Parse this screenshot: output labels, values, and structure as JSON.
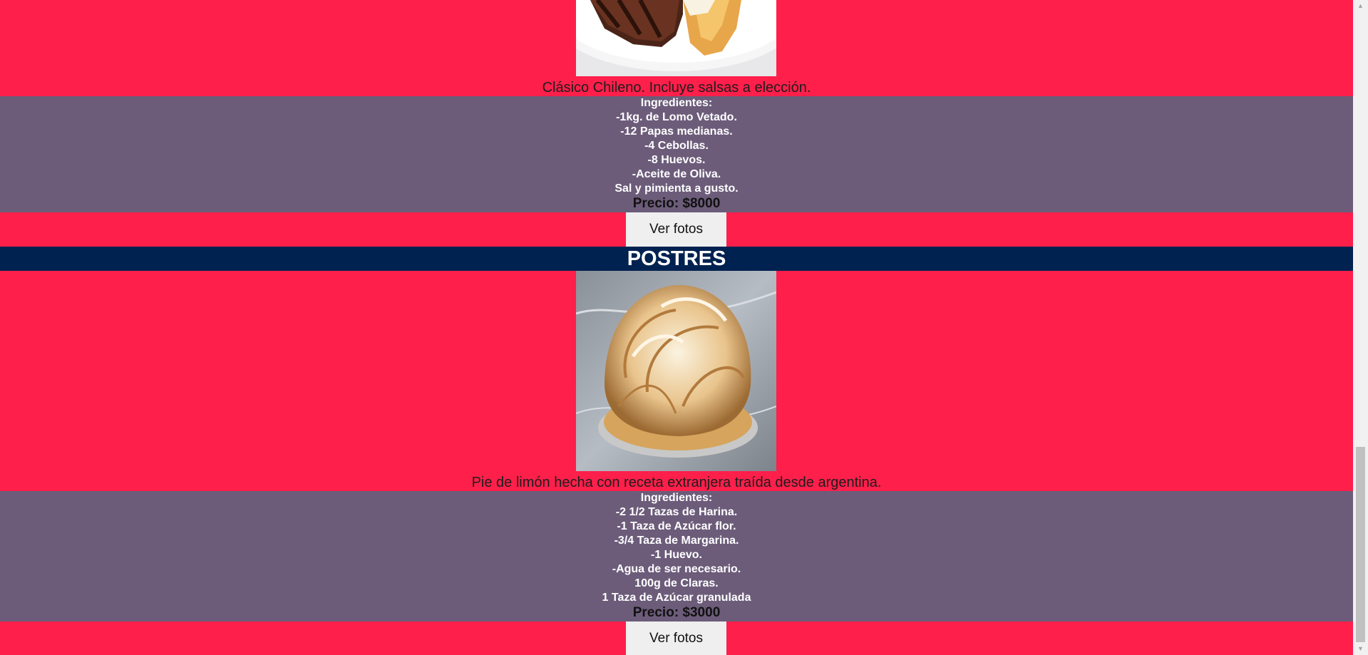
{
  "previous_item": {
    "description": "Clásico Chileno. Incluye salsas a elección.",
    "ingredients": [
      "Ingredientes:",
      "-1kg. de Lomo Vetado.",
      "-12 Papas medianas.",
      "-4 Cebollas.",
      "-8 Huevos.",
      "-Aceite de Oliva.",
      "Sal y pimienta a gusto."
    ],
    "price": "Precio: $8000",
    "button_label": "Ver fotos"
  },
  "section": {
    "title": "POSTRES"
  },
  "dessert_item": {
    "description": "Pie de limón hecha con receta extranjera traída desde argentina.",
    "ingredients": [
      "Ingredientes:",
      "-2 1/2 Tazas de Harina.",
      "-1 Taza de Azúcar flor.",
      "-3/4 Taza de Margarina.",
      "-1 Huevo.",
      "-Agua de ser necesario.",
      "100g de Claras.",
      "1 Taza de Azúcar granulada"
    ],
    "price": "Precio: $3000",
    "button_label": "Ver fotos"
  },
  "colors": {
    "page_background": "#ff1f4b",
    "ingredients_background": "#6c5c7a",
    "section_header_background": "#002250"
  },
  "icons": {
    "scroll_up": "scroll-up-arrow-icon",
    "scroll_down": "scroll-down-arrow-icon"
  }
}
